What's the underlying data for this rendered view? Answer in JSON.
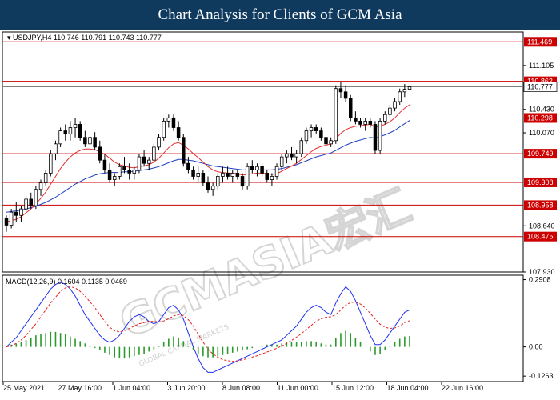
{
  "header": {
    "title": "Chart Analysis for Clients of GCM Asia"
  },
  "watermark": {
    "brand": "GCMASIA宏汇",
    "tagline": "GLOBAL CAPITAL MARKETS"
  },
  "colors": {
    "banner": "#0f3a5e",
    "level": "#cc0000",
    "current": "#808080",
    "ema_fast": "#e03030",
    "ema_slow": "#2040c0",
    "macd_line": "#1e2ff0",
    "signal_line": "#e02020",
    "histogram": "#2a9a2a"
  },
  "chart_data": [
    {
      "type": "line",
      "panel": "price",
      "title": "USDJPY,H4  110.746 110.791 110.743 110.777",
      "ylim": [
        107.93,
        111.62
      ],
      "y_ticks": [
        111.105,
        110.43,
        110.07,
        108.64,
        107.93
      ],
      "levels": [
        111.469,
        110.862,
        110.298,
        109.749,
        109.308,
        108.958,
        108.475
      ],
      "current_price": 110.777,
      "x_tick_labels": [
        "25 May 2021",
        "27 May 16:00",
        "1 Jun 04:00",
        "3 Jun 20:00",
        "8 Jun 08:00",
        "11 Jun 00:00",
        "15 Jun 12:00",
        "18 Jun 04:00",
        "22 Jun 16:00"
      ],
      "series": [
        {
          "type": "candlestick",
          "values": [
            [
              108.75,
              108.8,
              108.55,
              108.65
            ],
            [
              108.65,
              108.9,
              108.6,
              108.85
            ],
            [
              108.85,
              109.0,
              108.7,
              108.8
            ],
            [
              108.8,
              108.95,
              108.7,
              108.9
            ],
            [
              108.9,
              109.1,
              108.85,
              109.05
            ],
            [
              109.05,
              109.15,
              108.9,
              108.95
            ],
            [
              108.95,
              109.25,
              108.9,
              109.2
            ],
            [
              109.2,
              109.35,
              109.1,
              109.3
            ],
            [
              109.3,
              109.5,
              109.25,
              109.45
            ],
            [
              109.45,
              109.8,
              109.4,
              109.75
            ],
            [
              109.75,
              109.95,
              109.65,
              109.9
            ],
            [
              109.9,
              110.15,
              109.85,
              110.1
            ],
            [
              110.1,
              110.2,
              109.95,
              110.05
            ],
            [
              110.05,
              110.25,
              109.95,
              110.15
            ],
            [
              110.15,
              110.3,
              110.0,
              110.2
            ],
            [
              110.2,
              110.25,
              109.95,
              110.0
            ],
            [
              110.0,
              110.1,
              109.85,
              109.9
            ],
            [
              109.9,
              110.05,
              109.8,
              110.0
            ],
            [
              110.0,
              110.08,
              109.8,
              109.85
            ],
            [
              109.85,
              109.95,
              109.6,
              109.65
            ],
            [
              109.65,
              109.75,
              109.45,
              109.5
            ],
            [
              109.5,
              109.6,
              109.3,
              109.35
            ],
            [
              109.35,
              109.45,
              109.25,
              109.4
            ],
            [
              109.4,
              109.6,
              109.35,
              109.55
            ],
            [
              109.55,
              109.7,
              109.45,
              109.5
            ],
            [
              109.5,
              109.6,
              109.35,
              109.45
            ],
            [
              109.45,
              109.55,
              109.35,
              109.5
            ],
            [
              109.5,
              109.75,
              109.45,
              109.7
            ],
            [
              109.7,
              109.8,
              109.55,
              109.6
            ],
            [
              109.6,
              109.7,
              109.5,
              109.65
            ],
            [
              109.65,
              109.9,
              109.6,
              109.85
            ],
            [
              109.85,
              110.05,
              109.8,
              110.0
            ],
            [
              110.0,
              110.3,
              109.95,
              110.25
            ],
            [
              110.25,
              110.35,
              110.15,
              110.3
            ],
            [
              110.3,
              110.35,
              110.1,
              110.15
            ],
            [
              110.15,
              110.25,
              109.95,
              110.0
            ],
            [
              110.0,
              110.05,
              109.55,
              109.6
            ],
            [
              109.6,
              109.7,
              109.45,
              109.5
            ],
            [
              109.5,
              109.55,
              109.35,
              109.4
            ],
            [
              109.4,
              109.55,
              109.3,
              109.45
            ],
            [
              109.45,
              109.5,
              109.25,
              109.3
            ],
            [
              109.3,
              109.4,
              109.15,
              109.2
            ],
            [
              109.2,
              109.3,
              109.1,
              109.25
            ],
            [
              109.25,
              109.45,
              109.2,
              109.4
            ],
            [
              109.4,
              109.55,
              109.3,
              109.45
            ],
            [
              109.45,
              109.55,
              109.35,
              109.4
            ],
            [
              109.4,
              109.5,
              109.3,
              109.45
            ],
            [
              109.45,
              109.5,
              109.35,
              109.4
            ],
            [
              109.4,
              109.45,
              109.2,
              109.25
            ],
            [
              109.25,
              109.6,
              109.2,
              109.55
            ],
            [
              109.55,
              109.65,
              109.45,
              109.5
            ],
            [
              109.5,
              109.6,
              109.4,
              109.55
            ],
            [
              109.55,
              109.6,
              109.4,
              109.45
            ],
            [
              109.45,
              109.5,
              109.3,
              109.35
            ],
            [
              109.35,
              109.45,
              109.25,
              109.4
            ],
            [
              109.4,
              109.6,
              109.35,
              109.55
            ],
            [
              109.55,
              109.75,
              109.5,
              109.7
            ],
            [
              109.7,
              109.8,
              109.6,
              109.75
            ],
            [
              109.75,
              109.85,
              109.65,
              109.7
            ],
            [
              109.7,
              109.8,
              109.6,
              109.75
            ],
            [
              109.75,
              110.0,
              109.7,
              109.95
            ],
            [
              109.95,
              110.15,
              109.9,
              110.1
            ],
            [
              110.1,
              110.2,
              110.0,
              110.15
            ],
            [
              110.15,
              110.2,
              110.05,
              110.1
            ],
            [
              110.1,
              110.15,
              109.95,
              110.0
            ],
            [
              110.0,
              110.05,
              109.85,
              109.9
            ],
            [
              109.9,
              110.0,
              109.85,
              109.95
            ],
            [
              109.95,
              110.8,
              109.9,
              110.75
            ],
            [
              110.75,
              110.85,
              110.6,
              110.7
            ],
            [
              110.7,
              110.8,
              110.55,
              110.6
            ],
            [
              110.6,
              110.65,
              110.25,
              110.3
            ],
            [
              110.3,
              110.4,
              110.2,
              110.25
            ],
            [
              110.25,
              110.3,
              110.15,
              110.2
            ],
            [
              110.2,
              110.3,
              110.1,
              110.25
            ],
            [
              110.25,
              110.3,
              110.15,
              110.2
            ],
            [
              110.2,
              110.25,
              109.75,
              109.8
            ],
            [
              109.8,
              110.3,
              109.75,
              110.25
            ],
            [
              110.25,
              110.4,
              110.2,
              110.35
            ],
            [
              110.35,
              110.5,
              110.3,
              110.45
            ],
            [
              110.45,
              110.6,
              110.4,
              110.55
            ],
            [
              110.55,
              110.75,
              110.5,
              110.7
            ],
            [
              110.7,
              110.82,
              110.62,
              110.74
            ],
            [
              110.74,
              110.79,
              110.74,
              110.777
            ]
          ]
        },
        {
          "name": "",
          "style": "ema_fast",
          "values": [
            108.7,
            108.72,
            108.74,
            108.78,
            108.84,
            108.9,
            108.98,
            109.06,
            109.16,
            109.28,
            109.4,
            109.52,
            109.62,
            109.7,
            109.76,
            109.8,
            109.82,
            109.82,
            109.81,
            109.78,
            109.74,
            109.68,
            109.62,
            109.58,
            109.56,
            109.54,
            109.53,
            109.55,
            109.56,
            109.58,
            109.62,
            109.68,
            109.76,
            109.84,
            109.9,
            109.92,
            109.88,
            109.82,
            109.75,
            109.69,
            109.62,
            109.55,
            109.5,
            109.47,
            109.46,
            109.45,
            109.45,
            109.44,
            109.42,
            109.43,
            109.44,
            109.45,
            109.45,
            109.44,
            109.43,
            109.44,
            109.48,
            109.52,
            109.56,
            109.6,
            109.66,
            109.72,
            109.78,
            109.83,
            109.86,
            109.88,
            109.9,
            109.98,
            110.06,
            110.12,
            110.15,
            110.17,
            110.18,
            110.19,
            110.2,
            110.16,
            110.17,
            110.2,
            110.24,
            110.3,
            110.38,
            110.45,
            110.5
          ]
        },
        {
          "name": "",
          "style": "ema_slow",
          "values": [
            108.85,
            108.86,
            108.87,
            108.88,
            108.9,
            108.92,
            108.94,
            108.97,
            109.0,
            109.04,
            109.08,
            109.13,
            109.18,
            109.23,
            109.28,
            109.32,
            109.36,
            109.39,
            109.42,
            109.44,
            109.45,
            109.46,
            109.46,
            109.46,
            109.47,
            109.47,
            109.48,
            109.49,
            109.5,
            109.51,
            109.53,
            109.55,
            109.58,
            109.61,
            109.64,
            109.66,
            109.66,
            109.65,
            109.64,
            109.62,
            109.6,
            109.58,
            109.56,
            109.55,
            109.54,
            109.53,
            109.52,
            109.51,
            109.5,
            109.5,
            109.5,
            109.5,
            109.5,
            109.5,
            109.5,
            109.51,
            109.52,
            109.54,
            109.56,
            109.58,
            109.61,
            109.64,
            109.67,
            109.7,
            109.72,
            109.74,
            109.76,
            109.8,
            109.84,
            109.88,
            109.91,
            109.94,
            109.96,
            109.98,
            110.0,
            109.99,
            110.01,
            110.04,
            110.07,
            110.11,
            110.16,
            110.21,
            110.26
          ]
        }
      ]
    },
    {
      "type": "line",
      "panel": "macd",
      "title": "MACD(12,26,9) 0.1604 0.1135 0.0469",
      "ylim": [
        -0.15,
        0.31
      ],
      "y_ticks": [
        0.2908,
        0.0,
        -0.1263
      ],
      "series": [
        {
          "name": "",
          "style": "histogram",
          "values": [
            0.005,
            0.01,
            0.015,
            0.02,
            0.03,
            0.04,
            0.05,
            0.055,
            0.06,
            0.065,
            0.065,
            0.06,
            0.055,
            0.045,
            0.035,
            0.025,
            0.015,
            0.005,
            -0.005,
            -0.015,
            -0.025,
            -0.035,
            -0.045,
            -0.05,
            -0.05,
            -0.045,
            -0.04,
            -0.035,
            -0.03,
            -0.02,
            -0.01,
            0.005,
            0.02,
            0.035,
            0.045,
            0.04,
            0.025,
            0.005,
            -0.015,
            -0.03,
            -0.04,
            -0.045,
            -0.045,
            -0.04,
            -0.035,
            -0.03,
            -0.025,
            -0.02,
            -0.015,
            -0.01,
            -0.005,
            0.0,
            0.005,
            0.01,
            0.01,
            0.01,
            0.015,
            0.02,
            0.02,
            0.02,
            0.02,
            0.025,
            0.025,
            0.02,
            0.015,
            0.01,
            0.01,
            0.04,
            0.06,
            0.07,
            0.06,
            0.04,
            0.02,
            0.0,
            -0.02,
            -0.035,
            -0.03,
            -0.015,
            0.005,
            0.02,
            0.035,
            0.045,
            0.047
          ]
        },
        {
          "name": "",
          "style": "macd_line",
          "values": [
            0.0,
            0.02,
            0.04,
            0.07,
            0.1,
            0.13,
            0.16,
            0.19,
            0.22,
            0.25,
            0.27,
            0.28,
            0.27,
            0.25,
            0.22,
            0.18,
            0.14,
            0.11,
            0.08,
            0.05,
            0.03,
            0.02,
            0.03,
            0.05,
            0.08,
            0.11,
            0.13,
            0.14,
            0.13,
            0.11,
            0.1,
            0.11,
            0.14,
            0.17,
            0.18,
            0.16,
            0.12,
            0.06,
            0.0,
            -0.05,
            -0.09,
            -0.11,
            -0.11,
            -0.1,
            -0.09,
            -0.08,
            -0.07,
            -0.06,
            -0.05,
            -0.04,
            -0.03,
            -0.02,
            -0.01,
            0.0,
            0.01,
            0.02,
            0.03,
            0.05,
            0.07,
            0.09,
            0.12,
            0.15,
            0.17,
            0.18,
            0.17,
            0.15,
            0.14,
            0.19,
            0.23,
            0.26,
            0.24,
            0.2,
            0.15,
            0.1,
            0.05,
            0.01,
            0.01,
            0.03,
            0.06,
            0.09,
            0.12,
            0.15,
            0.16
          ]
        },
        {
          "name": "",
          "style": "signal_line",
          "values": [
            0.0,
            0.005,
            0.015,
            0.03,
            0.05,
            0.075,
            0.1,
            0.13,
            0.16,
            0.19,
            0.215,
            0.24,
            0.255,
            0.26,
            0.255,
            0.24,
            0.22,
            0.195,
            0.17,
            0.14,
            0.11,
            0.085,
            0.07,
            0.065,
            0.07,
            0.08,
            0.09,
            0.1,
            0.105,
            0.11,
            0.11,
            0.108,
            0.112,
            0.122,
            0.134,
            0.14,
            0.135,
            0.118,
            0.09,
            0.055,
            0.02,
            -0.01,
            -0.03,
            -0.045,
            -0.055,
            -0.06,
            -0.062,
            -0.06,
            -0.056,
            -0.05,
            -0.044,
            -0.038,
            -0.03,
            -0.022,
            -0.014,
            -0.006,
            0.004,
            0.015,
            0.028,
            0.042,
            0.058,
            0.075,
            0.093,
            0.11,
            0.122,
            0.128,
            0.13,
            0.14,
            0.16,
            0.18,
            0.192,
            0.194,
            0.185,
            0.168,
            0.145,
            0.12,
            0.098,
            0.085,
            0.08,
            0.082,
            0.09,
            0.105,
            0.1135
          ]
        }
      ]
    }
  ]
}
